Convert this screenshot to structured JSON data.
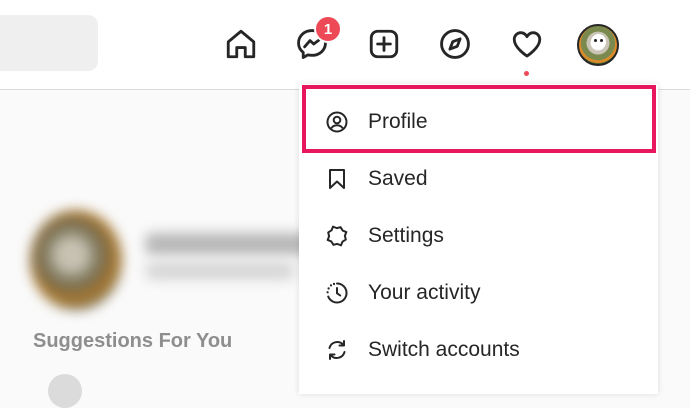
{
  "nav": {
    "icons": [
      "home-icon",
      "messenger-icon",
      "new-post-icon",
      "explore-icon",
      "activity-heart-icon",
      "profile-avatar"
    ],
    "messages_badge": "1",
    "badge_color": "#ed4956",
    "highlight_color": "#e8175d"
  },
  "dropdown": {
    "items": [
      {
        "label": "Profile",
        "icon": "profile-icon"
      },
      {
        "label": "Saved",
        "icon": "bookmark-icon"
      },
      {
        "label": "Settings",
        "icon": "settings-gear-icon"
      },
      {
        "label": "Your activity",
        "icon": "activity-clock-icon"
      },
      {
        "label": "Switch accounts",
        "icon": "switch-accounts-icon"
      }
    ]
  },
  "main": {
    "suggestions_heading": "Suggestions For You"
  }
}
